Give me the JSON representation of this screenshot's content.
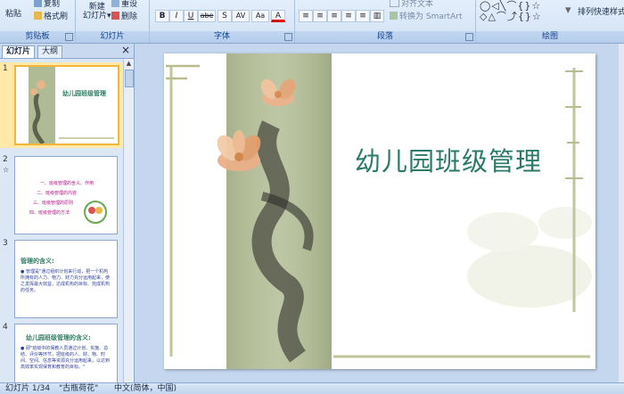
{
  "ribbon": {
    "clipboard": {
      "paste": "粘贴",
      "copy": "复制",
      "format_painter": "格式刷",
      "label": "剪贴板"
    },
    "slides": {
      "new_slide_1": "新建",
      "new_slide_2": "幻灯片",
      "reset": "重设",
      "delete": "删除",
      "label": "幻灯片"
    },
    "font": {
      "label": "字体",
      "bold": "B",
      "italic": "I",
      "underline": "U",
      "strike": "abe",
      "shadow": "S",
      "spacing": "AV",
      "case": "Aa",
      "color": "A"
    },
    "paragraph": {
      "label": "段落",
      "align_text": "对齐文本",
      "convert_smartart": "转换为 SmartArt"
    },
    "drawing": {
      "arrange": "排列",
      "quick_styles": "快速样式",
      "label": "绘图"
    }
  },
  "pane": {
    "tabs": [
      "幻灯片",
      "大纲"
    ],
    "close": "×"
  },
  "thumbnails": [
    {
      "number": "1",
      "title": "幼儿园班级管理"
    },
    {
      "number": "2",
      "lines": [
        "一、班级管理的含义、作用",
        "二、班级管理的内容",
        "三、班级管理的原则",
        "四、班级管理的方法"
      ]
    },
    {
      "number": "3",
      "title": "管理的含义:",
      "body": "● 管理是\"通过组织计划来行动，把一个机构所拥有的人力、物力、财力充分运用起来，使之发挥最大效益，达成机构的目标、完成机构的任务。"
    },
    {
      "number": "4",
      "title": "幼儿园班级管理的含义:",
      "body": "● 即\"班级中的保教人员通过计划、实施、总结、评价等环节，把班级的人、财、物、时间、空间、信息等资源充分运用起来，以达到高效率实现保育和教育的目标。\""
    }
  ],
  "slide": {
    "title": "幼儿园班级管理"
  },
  "status": {
    "slide_count": "幻灯片 1/34",
    "theme": "\"古瓶荷花\"",
    "language": "中文(简体，中国)"
  },
  "colors": {
    "accent": "#2b7a69",
    "selection": "#f0b73a"
  }
}
